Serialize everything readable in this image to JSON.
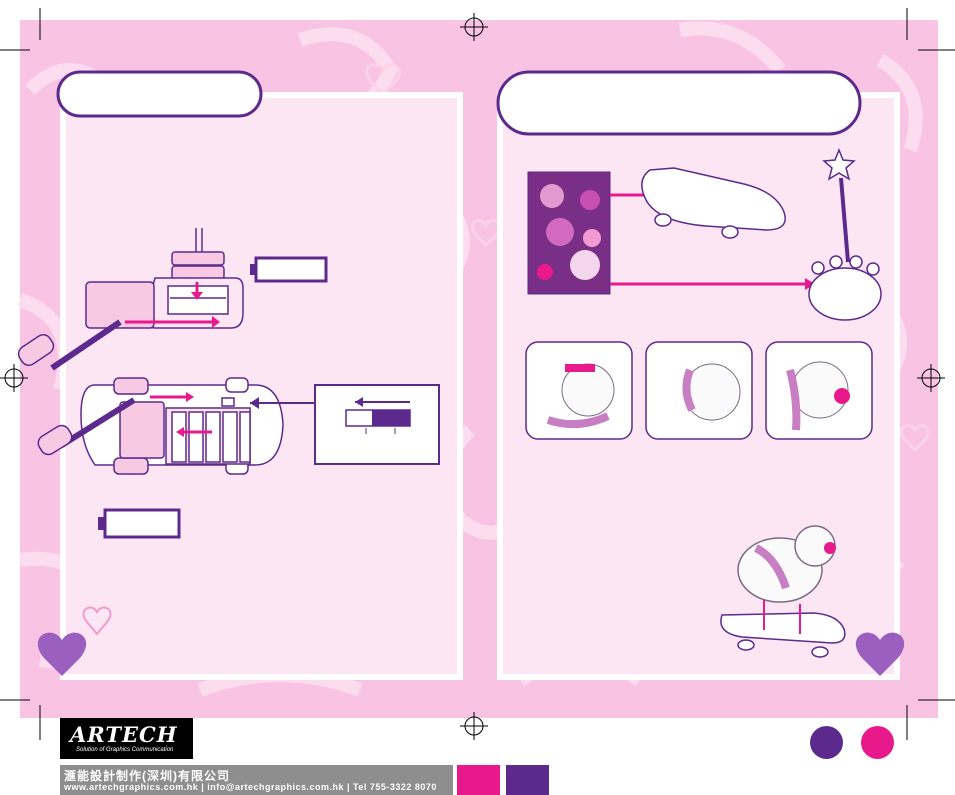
{
  "footer": {
    "logo_text": "ARTECH",
    "logo_tagline": "Solution of Graphics Communication",
    "company_line": "滙能設計制作(深圳)有限公司",
    "contact_line": "www.artechgraphics.com.hk | info@artechgraphics.com.hk | Tel 755-3322 8070"
  },
  "colors": {
    "page_background": "#f9c4e4",
    "panel": "#fde6f4",
    "accent_magenta": "#e8198b",
    "accent_purple": "#5c2a8c",
    "heart_purple": "#9b5fc0",
    "footer_gray": "#8e8e8e"
  },
  "left_page": {
    "heading_label": "",
    "battery_note_label": "",
    "figures": [
      "battery-compartment-figure",
      "car-underside-figure",
      "switch-detail-figure"
    ]
  },
  "right_page": {
    "heading_label": "",
    "figures": [
      "sticker-sheet",
      "skateboard",
      "wand",
      "remote-paw",
      "puppy-1",
      "puppy-2",
      "puppy-3",
      "puppy-on-skateboard"
    ]
  }
}
